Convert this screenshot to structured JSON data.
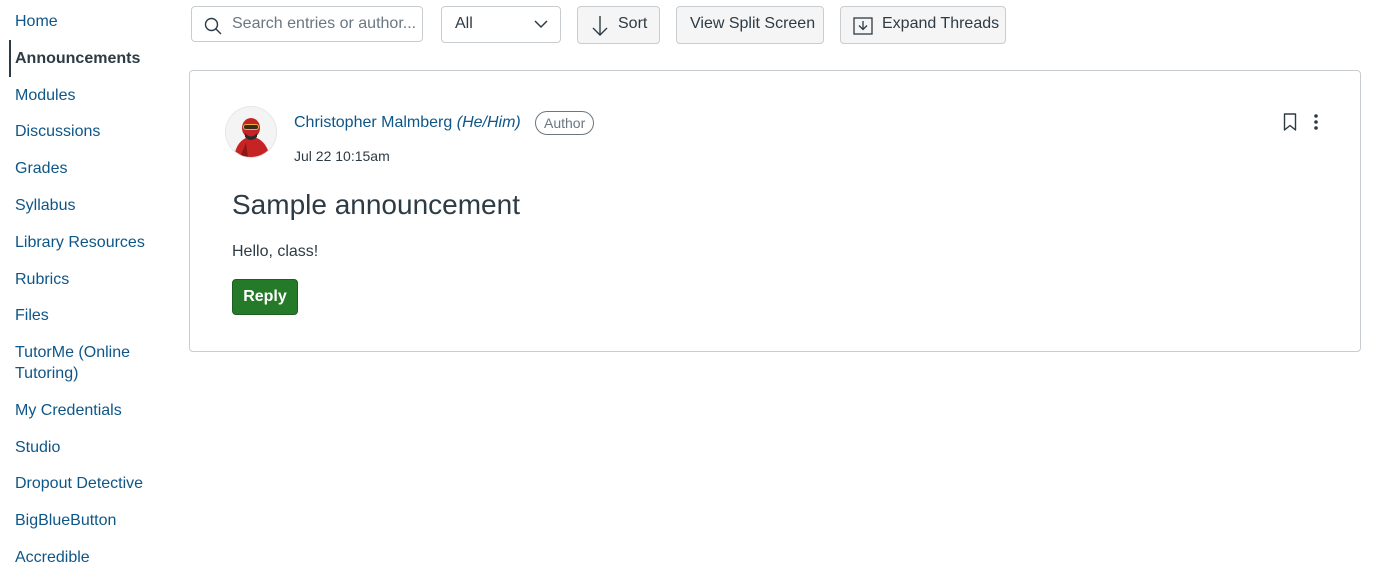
{
  "sidebar": {
    "items": [
      {
        "label": "Home"
      },
      {
        "label": "Announcements"
      },
      {
        "label": "Modules"
      },
      {
        "label": "Discussions"
      },
      {
        "label": "Grades"
      },
      {
        "label": "Syllabus"
      },
      {
        "label": "Library Resources"
      },
      {
        "label": "Rubrics"
      },
      {
        "label": "Files"
      },
      {
        "label": "TutorMe (Online Tutoring)"
      },
      {
        "label": "My Credentials"
      },
      {
        "label": "Studio"
      },
      {
        "label": "Dropout Detective"
      },
      {
        "label": "BigBlueButton"
      },
      {
        "label": "Accredible"
      }
    ],
    "active": "Announcements"
  },
  "toolbar": {
    "search_placeholder": "Search entries or author...",
    "search_value": "",
    "filter_value": "All",
    "sort_label": "Sort",
    "split_screen_label": "View Split Screen",
    "expand_threads_label": "Expand Threads"
  },
  "post": {
    "author_name": "Christopher Malmberg",
    "author_pronouns": "(He/Him)",
    "author_badge": "Author",
    "timestamp": "Jul 22 10:15am",
    "title": "Sample announcement",
    "body": "Hello, class!",
    "reply_label": "Reply"
  },
  "colors": {
    "link": "#0e5687",
    "text": "#2d3b45",
    "reply_button": "#257a2a",
    "border": "#c7cdd1"
  },
  "icons": {
    "search": "search-icon",
    "filter": "chevron-down-icon",
    "sort": "arrow-down-icon",
    "expand": "expand-threads-icon",
    "bookmark": "bookmark-icon",
    "more": "more-vertical-icon"
  }
}
